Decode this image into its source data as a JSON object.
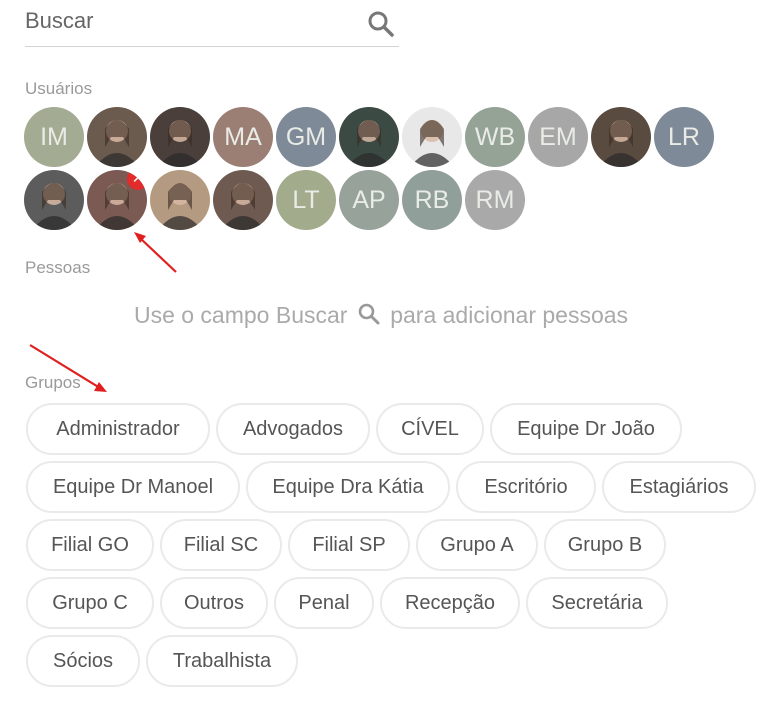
{
  "search": {
    "placeholder": "Buscar",
    "icon": "search-icon"
  },
  "users_section": {
    "label": "Usuários"
  },
  "users": [
    {
      "initials": "IM",
      "color": "#a3ab93",
      "photo": false
    },
    {
      "initials": "",
      "color": "#6b5a4e",
      "photo": true
    },
    {
      "initials": "",
      "color": "#4a3f3a",
      "photo": true
    },
    {
      "initials": "MA",
      "color": "#9c7f74",
      "photo": false
    },
    {
      "initials": "GM",
      "color": "#7e8a97",
      "photo": false
    },
    {
      "initials": "",
      "color": "#3c4a44",
      "photo": true
    },
    {
      "initials": "",
      "color": "#e8e8e8",
      "photo": true
    },
    {
      "initials": "WB",
      "color": "#95a296",
      "photo": false
    },
    {
      "initials": "EM",
      "color": "#a7a7a7",
      "photo": false
    },
    {
      "initials": "",
      "color": "#5a4b40",
      "photo": true
    },
    {
      "initials": "LR",
      "color": "#7f8a98",
      "photo": false
    },
    {
      "initials": "",
      "color": "#5c5c5c",
      "photo": true
    },
    {
      "initials": "",
      "color": "#7a5a52",
      "photo": true,
      "removable": true,
      "remove_icon": "close-icon"
    },
    {
      "initials": "",
      "color": "#b49a80",
      "photo": true
    },
    {
      "initials": "",
      "color": "#6e5a50",
      "photo": true
    },
    {
      "initials": "LT",
      "color": "#a3ab8d",
      "photo": false
    },
    {
      "initials": "AP",
      "color": "#97a39a",
      "photo": false
    },
    {
      "initials": "RB",
      "color": "#909f9a",
      "photo": false
    },
    {
      "initials": "RM",
      "color": "#a9a9a9",
      "photo": false
    }
  ],
  "people_section": {
    "label": "Pessoas",
    "hint_before": "Use o campo  Buscar",
    "hint_after": "para adicionar pessoas"
  },
  "groups_section": {
    "label": "Grupos"
  },
  "groups": [
    "Administrador",
    "Advogados",
    "CÍVEL",
    "Equipe Dr João",
    "Equipe Dr Manoel",
    "Equipe Dra Kátia",
    "Escritório",
    "Estagiários",
    "Filial GO",
    "Filial SC",
    "Filial SP",
    "Grupo A",
    "Grupo B",
    "Grupo C",
    "Outros",
    "Penal",
    "Recepção",
    "Secretária",
    "Sócios",
    "Trabalhista"
  ],
  "colors": {
    "arrow": "#e02020",
    "remove_badge": "#e22b2b"
  }
}
